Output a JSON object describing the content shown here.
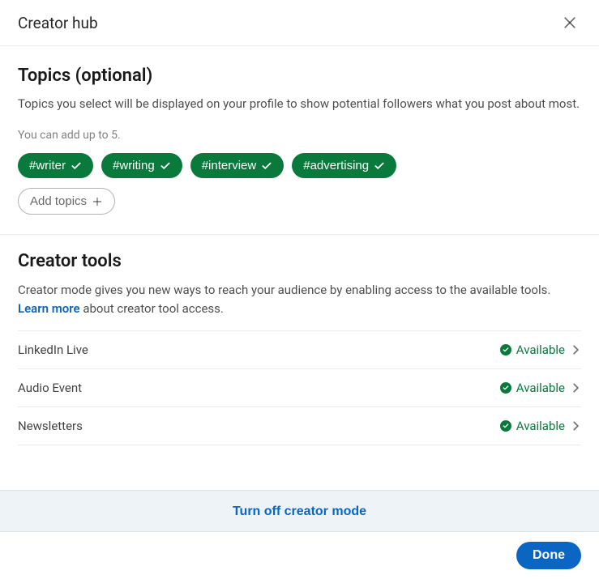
{
  "header": {
    "title": "Creator hub"
  },
  "topics_section": {
    "title": "Topics (optional)",
    "description": "Topics you select will be displayed on your profile to show potential followers what you post about most.",
    "limit_text": "You can add up to 5.",
    "topics": [
      {
        "label": "#writer"
      },
      {
        "label": "#writing"
      },
      {
        "label": "#interview"
      },
      {
        "label": "#advertising"
      }
    ],
    "add_label": "Add topics"
  },
  "tools_section": {
    "title": "Creator tools",
    "description_pre": "Creator mode gives you new ways to reach your audience by enabling access to the available tools. ",
    "learn_more_label": "Learn more",
    "description_post": " about creator tool access.",
    "tools": [
      {
        "name": "LinkedIn Live",
        "status": "Available"
      },
      {
        "name": "Audio Event",
        "status": "Available"
      },
      {
        "name": "Newsletters",
        "status": "Available"
      }
    ]
  },
  "footer": {
    "turn_off_label": "Turn off creator mode",
    "done_label": "Done"
  }
}
